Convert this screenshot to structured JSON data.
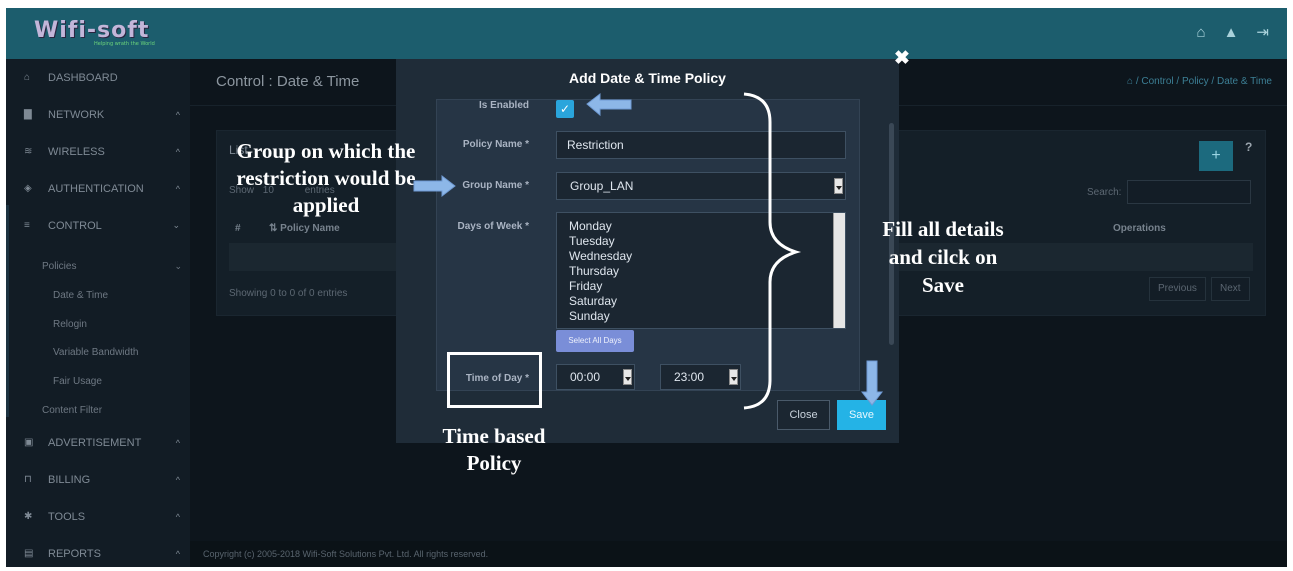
{
  "header": {
    "logo_text": "Wifi-soft",
    "logo_tagline": "Helping wrath the World",
    "icons": [
      "home-icon",
      "bell-icon",
      "logout-icon"
    ]
  },
  "sidebar": {
    "items": [
      {
        "label": "DASHBOARD",
        "icon": "home-icon"
      },
      {
        "label": "NETWORK",
        "icon": "server-icon"
      },
      {
        "label": "WIRELESS",
        "icon": "wifi-icon"
      },
      {
        "label": "AUTHENTICATION",
        "icon": "shield-icon"
      },
      {
        "label": "CONTROL",
        "icon": "database-icon"
      },
      {
        "label": "ADVERTISEMENT",
        "icon": "ad-icon"
      },
      {
        "label": "BILLING",
        "icon": "billing-icon"
      },
      {
        "label": "TOOLS",
        "icon": "gear-icon"
      },
      {
        "label": "REPORTS",
        "icon": "report-icon"
      }
    ],
    "policies_label": "Policies",
    "sub_items": [
      "Date & Time",
      "Relogin",
      "Variable Bandwidth",
      "Fair Usage"
    ],
    "content_filter": "Content Filter"
  },
  "main": {
    "page_title": "Control : Date & Time",
    "breadcrumb": "/ Control / Policy / Date & Time",
    "panel_heading": "List",
    "show_label": "Show",
    "show_value": "10",
    "entries_label": "entries",
    "columns": [
      "#",
      "Policy Name",
      "Operations"
    ],
    "search_label": "Search:",
    "showing_text": "Showing 0 to 0 of 0 entries",
    "previous": "Previous",
    "next": "Next",
    "help": "?"
  },
  "modal": {
    "title": "Add Date & Time Policy",
    "close_glyph": "✖",
    "is_enabled_label": "Is Enabled",
    "is_enabled": true,
    "policy_name_label": "Policy Name *",
    "policy_name_value": "Restriction",
    "group_name_label": "Group Name *",
    "group_name_value": "Group_LAN",
    "days_label": "Days of Week *",
    "days": [
      "Monday",
      "Tuesday",
      "Wednesday",
      "Thursday",
      "Friday",
      "Saturday",
      "Sunday"
    ],
    "select_all_days": "Select All Days",
    "time_label": "Time of Day *",
    "time_from": "00:00",
    "time_to": "23:00",
    "close_button": "Close",
    "save_button": "Save"
  },
  "annotations": {
    "group_note": "Group on which the restriction would be applied",
    "fill_note": "Fill all details and cilck on Save",
    "time_note": "Time based Policy"
  },
  "footer": {
    "copyright": "Copyright (c) 2005-2018 Wifi-Soft Solutions Pvt. Ltd. All rights reserved."
  },
  "colors": {
    "topbar": "#1c5d6d",
    "save": "#24b3e6",
    "select_all": "#7a8ed8"
  }
}
